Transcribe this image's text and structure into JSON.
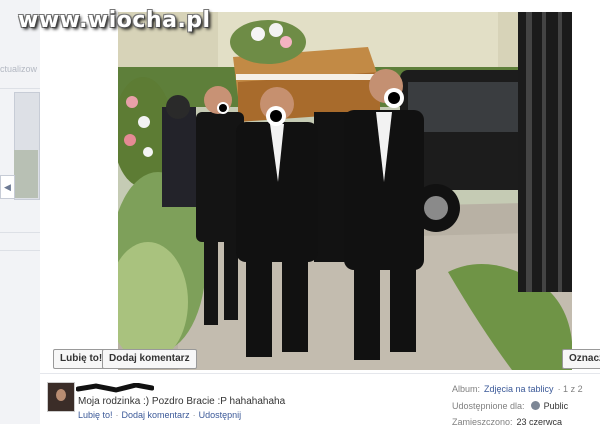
{
  "watermark": "www.wiocha.pl",
  "left_panel": {
    "label": "ctualizow",
    "arrow": "◀"
  },
  "photo_buttons": {
    "like": "Lubię to!",
    "comment": "Dodaj komentarz",
    "tag": "Oznacz"
  },
  "post": {
    "caption": "Moja rodzinka :) Pozdro Bracie :P hahahahaha",
    "actions": [
      "Lubię to!",
      "Dodaj komentarz",
      "Udostępnij"
    ]
  },
  "meta": {
    "album_label": "Album:",
    "album_value": "Zdjęcia na tablicy",
    "pager": "· 1 z 2",
    "shared_label": "Udostępnione dla:",
    "shared_value": "Public",
    "added_label": "Zamieszczono:",
    "added_value": "23 czerwca"
  },
  "colors": {
    "link": "#3b5998",
    "muted": "#808080"
  }
}
